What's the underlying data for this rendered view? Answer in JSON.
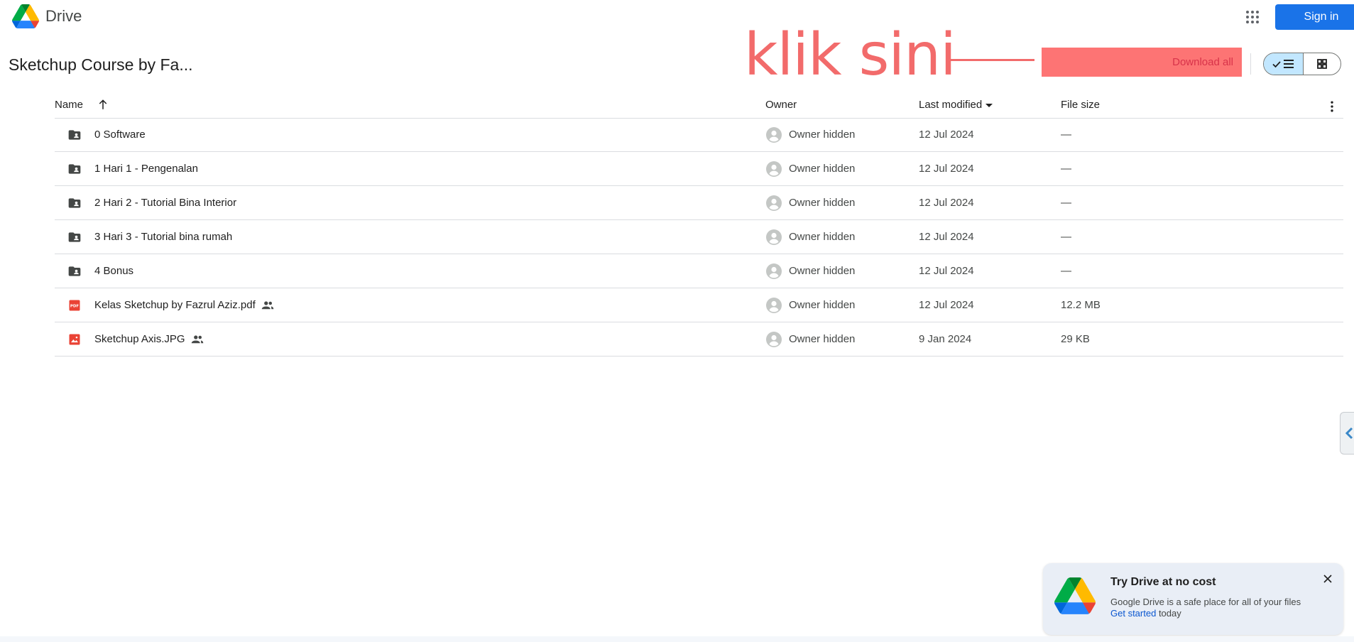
{
  "header": {
    "brand": "Drive",
    "sign_in_label": "Sign in"
  },
  "folder_title": "Sketchup Course by Fa...",
  "annotation": {
    "text": "klik sini"
  },
  "toolbar": {
    "download_all_label": "Download all"
  },
  "table": {
    "columns": {
      "name": "Name",
      "owner": "Owner",
      "last_modified": "Last modified",
      "file_size": "File size"
    },
    "rows": [
      {
        "name": "0 Software",
        "type": "folder",
        "shared": false,
        "owner": "Owner hidden",
        "modified": "12 Jul 2024",
        "size": "—"
      },
      {
        "name": "1 Hari 1 - Pengenalan",
        "type": "folder",
        "shared": false,
        "owner": "Owner hidden",
        "modified": "12 Jul 2024",
        "size": "—"
      },
      {
        "name": "2 Hari 2 - Tutorial Bina Interior",
        "type": "folder",
        "shared": false,
        "owner": "Owner hidden",
        "modified": "12 Jul 2024",
        "size": "—"
      },
      {
        "name": "3 Hari 3 - Tutorial bina rumah",
        "type": "folder",
        "shared": false,
        "owner": "Owner hidden",
        "modified": "12 Jul 2024",
        "size": "—"
      },
      {
        "name": "4 Bonus",
        "type": "folder",
        "shared": false,
        "owner": "Owner hidden",
        "modified": "12 Jul 2024",
        "size": "—"
      },
      {
        "name": "Kelas Sketchup by Fazrul Aziz.pdf",
        "type": "pdf",
        "shared": true,
        "owner": "Owner hidden",
        "modified": "12 Jul 2024",
        "size": "12.2 MB"
      },
      {
        "name": "Sketchup Axis.JPG",
        "type": "image",
        "shared": true,
        "owner": "Owner hidden",
        "modified": "9 Jan 2024",
        "size": "29 KB"
      }
    ]
  },
  "promo": {
    "title": "Try Drive at no cost",
    "body": "Google Drive is a safe place for all of your files",
    "link": "Get started",
    "suffix": "today"
  },
  "icons": {
    "logo": "google-drive-logo",
    "apps": "apps-grid-icon",
    "sort": "arrow-up-icon",
    "sort_desc": "caret-down-icon",
    "more": "more-vert-icon",
    "list_view": "list-view-icon",
    "grid_view": "grid-view-icon",
    "close": "close-icon"
  },
  "colors": {
    "accent": "#1a73e8",
    "annotation": "#f26b6b",
    "download_highlight": "#fd7474",
    "toggle_selected": "#c2e7ff",
    "pdf_red": "#ea4335"
  }
}
